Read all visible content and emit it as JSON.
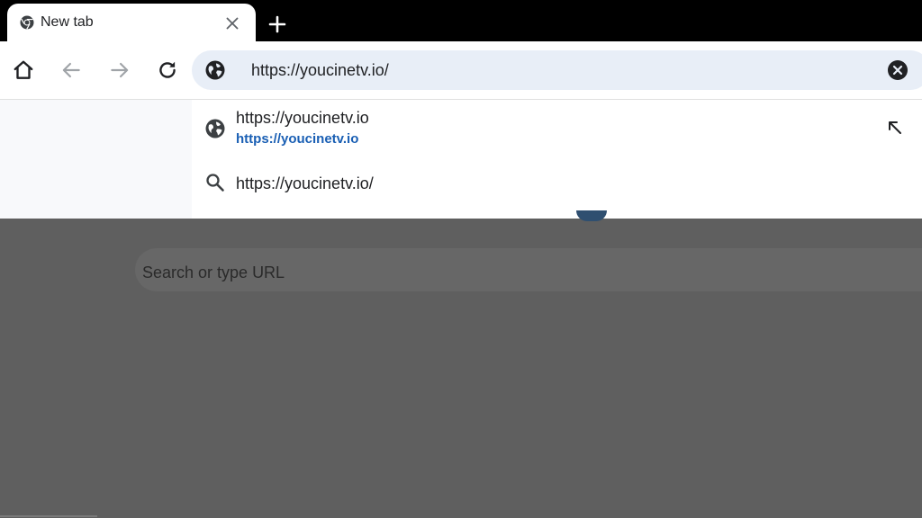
{
  "tab": {
    "title": "New tab",
    "favicon": "chrome-icon"
  },
  "toolbar": {
    "buttons": [
      "home-icon",
      "back-icon",
      "forward-icon",
      "reload-icon"
    ]
  },
  "omnibox": {
    "value": "https://youcinetv.io/",
    "leading_icon": "globe-icon",
    "trailing_icon": "clear-icon"
  },
  "suggestions": [
    {
      "icon": "globe-icon",
      "title": "https://youcinetv.io",
      "url": "https://youcinetv.io",
      "action_icon": "fill-arrow-icon"
    },
    {
      "icon": "search-icon",
      "title": "https://youcinetv.io/"
    }
  ],
  "ntp": {
    "search_placeholder": "Search or type URL"
  },
  "colors": {
    "tabstrip": "#000000",
    "omnibox_bg": "#e8eef7",
    "link_blue": "#1a5fb4",
    "scrim": "#5f5f5f"
  }
}
